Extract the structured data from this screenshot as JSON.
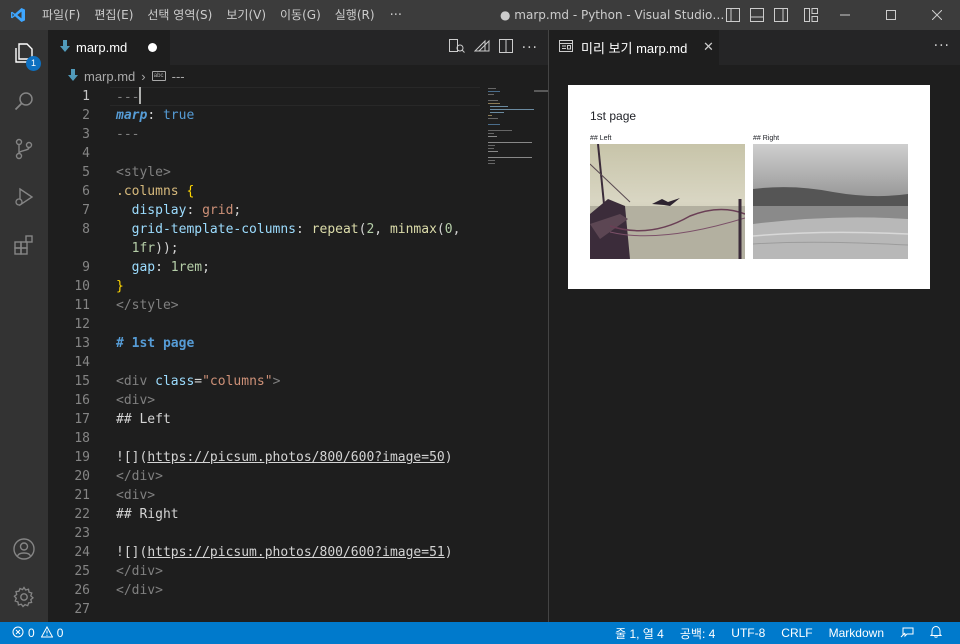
{
  "titlebar": {
    "menu": [
      "파일(F)",
      "편집(E)",
      "선택 영역(S)",
      "보기(V)",
      "이동(G)",
      "실행(R)"
    ],
    "menu_more": "···",
    "title": "● marp.md - Python - Visual Studio Code"
  },
  "activity": {
    "explorer_badge": "1"
  },
  "editor": {
    "tab_label": "marp.md",
    "breadcrumb_file": "marp.md",
    "breadcrumb_symbol": "---",
    "actions_more": "···",
    "line_numbers": [
      "1",
      "2",
      "3",
      "4",
      "5",
      "6",
      "7",
      "8",
      "",
      "9",
      "10",
      "11",
      "12",
      "13",
      "14",
      "15",
      "16",
      "17",
      "18",
      "19",
      "20",
      "21",
      "22",
      "23",
      "24",
      "25",
      "26",
      "27"
    ],
    "lines": {
      "l1": "---",
      "l2_key": "marp",
      "l2_colon": ": ",
      "l2_val": "true",
      "l3": "---",
      "l5": "<style>",
      "l6_sel": ".columns",
      "l6_brace": " {",
      "l7_prop": "  display",
      "l7_colon": ": ",
      "l7_val": "grid",
      "l7_end": ";",
      "l8_prop": "  grid-template-columns",
      "l8_colon": ": ",
      "l8_fn": "repeat",
      "l8_open": "(",
      "l8_num": "2",
      "l8_comma": ", ",
      "l8_fn2": "minmax",
      "l8_open2": "(",
      "l8_num2": "0",
      "l8_comma2": ",",
      "l8w_num": "  1fr",
      "l8w_end": "));",
      "l9_prop": "  gap",
      "l9_colon": ": ",
      "l9_num": "1rem",
      "l9_end": ";",
      "l10": "}",
      "l11": "</style>",
      "l13": "# 1st page",
      "l15_open": "<div ",
      "l15_attr": "class",
      "l15_eq": "=",
      "l15_str": "\"columns\"",
      "l15_close": ">",
      "l16": "<div>",
      "l17": "## Left",
      "l19_pre": "![](",
      "l19_link": "https://picsum.photos/800/600?image=50",
      "l19_post": ")",
      "l20": "</div>",
      "l21": "<div>",
      "l22": "## Right",
      "l24_pre": "![](",
      "l24_link": "https://picsum.photos/800/600?image=51",
      "l24_post": ")",
      "l25": "</div>",
      "l26": "</div>"
    }
  },
  "preview": {
    "tab_label": "미리 보기 marp.md",
    "close": "✕",
    "more": "···",
    "slide_title": "1st page",
    "col_left": "## Left",
    "col_right": "## Right"
  },
  "statusbar": {
    "errors": "0",
    "warnings": "0",
    "position": "줄 1, 열 4",
    "spaces": "공백: 4",
    "encoding": "UTF-8",
    "eol": "CRLF",
    "language": "Markdown"
  },
  "colors": {
    "accent": "#007acc",
    "titlebar": "#3c3c3c",
    "activitybar": "#333333",
    "editor_bg": "#1e1e1e"
  }
}
